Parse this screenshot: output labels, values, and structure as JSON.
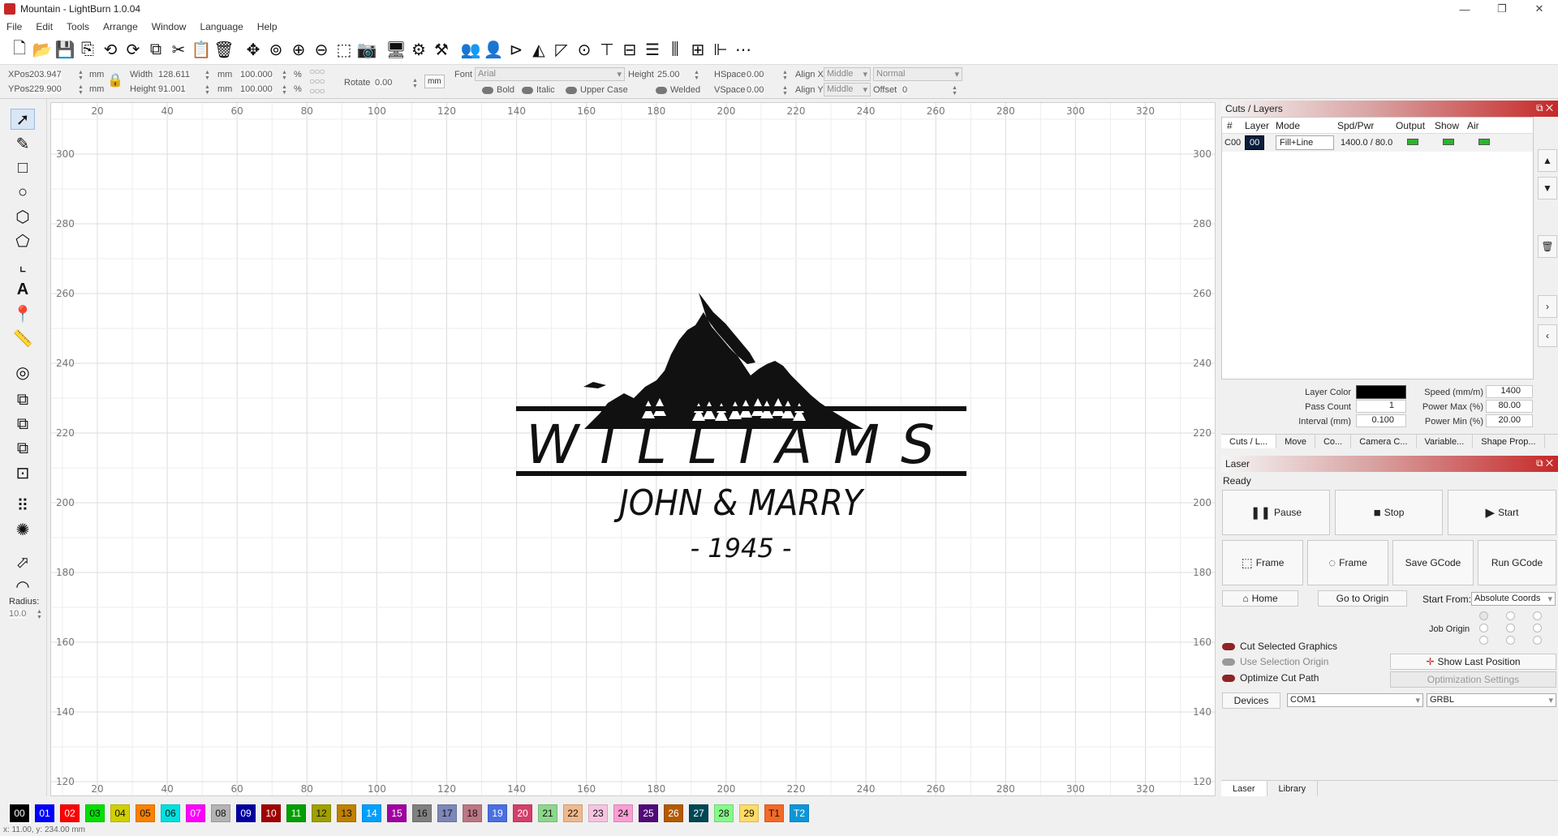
{
  "window": {
    "title": "Mountain - LightBurn 1.0.04"
  },
  "menu": [
    "File",
    "Edit",
    "Tools",
    "Arrange",
    "Window",
    "Language",
    "Help"
  ],
  "props": {
    "xpos_label": "XPos",
    "xpos": "203.947",
    "ypos_label": "YPos",
    "ypos": "229.900",
    "unit": "mm",
    "width_label": "Width",
    "width": "128.611",
    "height_label": "Height",
    "height": "91.001",
    "scale_w": "100.000",
    "scale_h": "100.000",
    "pct": "%",
    "rotate_label": "Rotate",
    "rotate": "0.00",
    "mm_btn": "mm",
    "font_label": "Font",
    "font": "Arial",
    "font_height_label": "Height",
    "font_height": "25.00",
    "hspace_label": "HSpace",
    "hspace": "0.00",
    "vspace_label": "VSpace",
    "vspace": "0.00",
    "alignx_label": "Align X",
    "alignx": "Middle",
    "aligny_label": "Align Y",
    "aligny": "Middle",
    "normal": "Normal",
    "offset_label": "Offset",
    "offset": "0",
    "bold": "Bold",
    "italic": "Italic",
    "upper": "Upper Case",
    "welded": "Welded"
  },
  "tools": {
    "radius_label": "Radius:",
    "radius": "10.0"
  },
  "ruler": {
    "top": [
      "20",
      "40",
      "60",
      "80",
      "100",
      "120",
      "140",
      "160",
      "180",
      "200",
      "220",
      "240",
      "260",
      "280",
      "300",
      "320"
    ],
    "left": [
      "300",
      "280",
      "260",
      "240",
      "220",
      "200",
      "180",
      "160",
      "140",
      "120"
    ]
  },
  "design": {
    "name": "WILLIAMS",
    "sub": "JOHN & MARRY",
    "year": "- 1945 -"
  },
  "palette": [
    {
      "l": "00",
      "c": "#000000",
      "t": "#ffffff"
    },
    {
      "l": "01",
      "c": "#0000ff",
      "t": "#ffffff"
    },
    {
      "l": "02",
      "c": "#ff0000",
      "t": "#ffffff"
    },
    {
      "l": "03",
      "c": "#00e000",
      "t": "#111111"
    },
    {
      "l": "04",
      "c": "#d0d000",
      "t": "#111111"
    },
    {
      "l": "05",
      "c": "#ff8000",
      "t": "#111111"
    },
    {
      "l": "06",
      "c": "#00e0e0",
      "t": "#111111"
    },
    {
      "l": "07",
      "c": "#ff00ff",
      "t": "#ffffff"
    },
    {
      "l": "08",
      "c": "#b4b4b4",
      "t": "#111111"
    },
    {
      "l": "09",
      "c": "#0000a0",
      "t": "#ffffff"
    },
    {
      "l": "10",
      "c": "#a00000",
      "t": "#ffffff"
    },
    {
      "l": "11",
      "c": "#00a000",
      "t": "#ffffff"
    },
    {
      "l": "12",
      "c": "#a0a000",
      "t": "#111111"
    },
    {
      "l": "13",
      "c": "#c08000",
      "t": "#111111"
    },
    {
      "l": "14",
      "c": "#00a0ff",
      "t": "#ffffff"
    },
    {
      "l": "15",
      "c": "#a000a0",
      "t": "#ffffff"
    },
    {
      "l": "16",
      "c": "#808080",
      "t": "#111111"
    },
    {
      "l": "17",
      "c": "#7d87b9",
      "t": "#111111"
    },
    {
      "l": "18",
      "c": "#bb7784",
      "t": "#111111"
    },
    {
      "l": "19",
      "c": "#4a6fe3",
      "t": "#ffffff"
    },
    {
      "l": "20",
      "c": "#d33f6a",
      "t": "#ffffff"
    },
    {
      "l": "21",
      "c": "#8cd78c",
      "t": "#111111"
    },
    {
      "l": "22",
      "c": "#f0b98d",
      "t": "#111111"
    },
    {
      "l": "23",
      "c": "#f6c4e1",
      "t": "#111111"
    },
    {
      "l": "24",
      "c": "#fa9ed4",
      "t": "#111111"
    },
    {
      "l": "25",
      "c": "#500a78",
      "t": "#ffffff"
    },
    {
      "l": "26",
      "c": "#b45a00",
      "t": "#ffffff"
    },
    {
      "l": "27",
      "c": "#004754",
      "t": "#ffffff"
    },
    {
      "l": "28",
      "c": "#86fa88",
      "t": "#111111"
    },
    {
      "l": "29",
      "c": "#ffdb66",
      "t": "#111111"
    },
    {
      "l": "T1",
      "c": "#f36926",
      "t": "#111111"
    },
    {
      "l": "T2",
      "c": "#0c96d9",
      "t": "#ffffff"
    }
  ],
  "status": "x: 11.00, y: 234.00 mm",
  "cuts": {
    "title": "Cuts / Layers",
    "headers": [
      "#",
      "Layer",
      "Mode",
      "Spd/Pwr",
      "Output",
      "Show",
      "Air"
    ],
    "row": {
      "num": "C00",
      "layer": "00",
      "mode": "Fill+Line",
      "spdpwr": "1400.0 / 80.0"
    },
    "layer_color_label": "Layer Color",
    "speed_label": "Speed (mm/m)",
    "speed": "1400",
    "pass_label": "Pass Count",
    "pass": "1",
    "pmax_label": "Power Max (%)",
    "pmax": "80.00",
    "interval_label": "Interval (mm)",
    "interval": "0.100",
    "pmin_label": "Power Min (%)",
    "pmin": "20.00",
    "tabs": [
      "Cuts / L...",
      "Move",
      "Co...",
      "Camera C...",
      "Variable...",
      "Shape Prop..."
    ]
  },
  "laser": {
    "title": "Laser",
    "state": "Ready",
    "pause": "Pause",
    "stop": "Stop",
    "start": "Start",
    "frame1": "Frame",
    "frame2": "Frame",
    "save": "Save GCode",
    "run": "Run GCode",
    "home": "Home",
    "origin": "Go to Origin",
    "start_from_label": "Start From:",
    "start_from": "Absolute Coords",
    "job_origin": "Job Origin",
    "cut_selected": "Cut Selected Graphics",
    "use_sel": "Use Selection Origin",
    "optimize": "Optimize Cut Path",
    "show_last": "Show Last Position",
    "opt_settings": "Optimization Settings",
    "devices": "Devices",
    "port": "COM1",
    "controller": "GRBL",
    "tab_laser": "Laser",
    "tab_library": "Library"
  }
}
